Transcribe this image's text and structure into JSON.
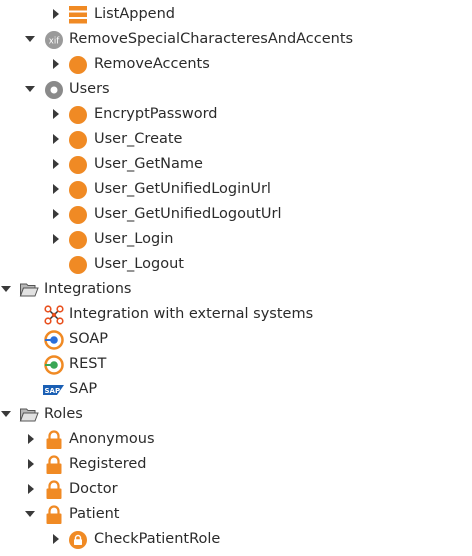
{
  "colors": {
    "orange": "#f08a24",
    "text": "#2b2b2b",
    "arrow": "#3a3a3a",
    "gray_icon": "#8a8a8a"
  },
  "tree": {
    "items": [
      {
        "label": "ListAppend",
        "icon": "structure-icon",
        "arrow": "collapsed"
      },
      {
        "label": "RemoveSpecialCharacteresAndAccents",
        "icon": "extension-xif-icon",
        "arrow": "expanded"
      },
      {
        "label": "RemoveAccents",
        "icon": "action-icon",
        "arrow": "collapsed"
      },
      {
        "label": "Users",
        "icon": "module-icon",
        "arrow": "expanded"
      },
      {
        "label": "EncryptPassword",
        "icon": "action-icon",
        "arrow": "collapsed"
      },
      {
        "label": "User_Create",
        "icon": "action-icon",
        "arrow": "collapsed"
      },
      {
        "label": "User_GetName",
        "icon": "action-icon",
        "arrow": "collapsed"
      },
      {
        "label": "User_GetUnifiedLoginUrl",
        "icon": "action-icon",
        "arrow": "collapsed"
      },
      {
        "label": "User_GetUnifiedLogoutUrl",
        "icon": "action-icon",
        "arrow": "collapsed"
      },
      {
        "label": "User_Login",
        "icon": "action-icon",
        "arrow": "collapsed"
      },
      {
        "label": "User_Logout",
        "icon": "action-icon",
        "arrow": "none"
      },
      {
        "label": "Integrations",
        "icon": "folder-open-icon",
        "arrow": "expanded"
      },
      {
        "label": "Integration with external systems",
        "icon": "integration-icon",
        "arrow": "none"
      },
      {
        "label": "SOAP",
        "icon": "soap-icon",
        "arrow": "none"
      },
      {
        "label": "REST",
        "icon": "rest-icon",
        "arrow": "none"
      },
      {
        "label": "SAP",
        "icon": "sap-icon",
        "arrow": "none"
      },
      {
        "label": "Roles",
        "icon": "folder-open-icon",
        "arrow": "expanded"
      },
      {
        "label": "Anonymous",
        "icon": "lock-icon",
        "arrow": "collapsed"
      },
      {
        "label": "Registered",
        "icon": "lock-icon",
        "arrow": "collapsed"
      },
      {
        "label": "Doctor",
        "icon": "lock-icon",
        "arrow": "collapsed"
      },
      {
        "label": "Patient",
        "icon": "lock-icon",
        "arrow": "expanded"
      },
      {
        "label": "CheckPatientRole",
        "icon": "check-role-icon",
        "arrow": "collapsed"
      }
    ]
  }
}
